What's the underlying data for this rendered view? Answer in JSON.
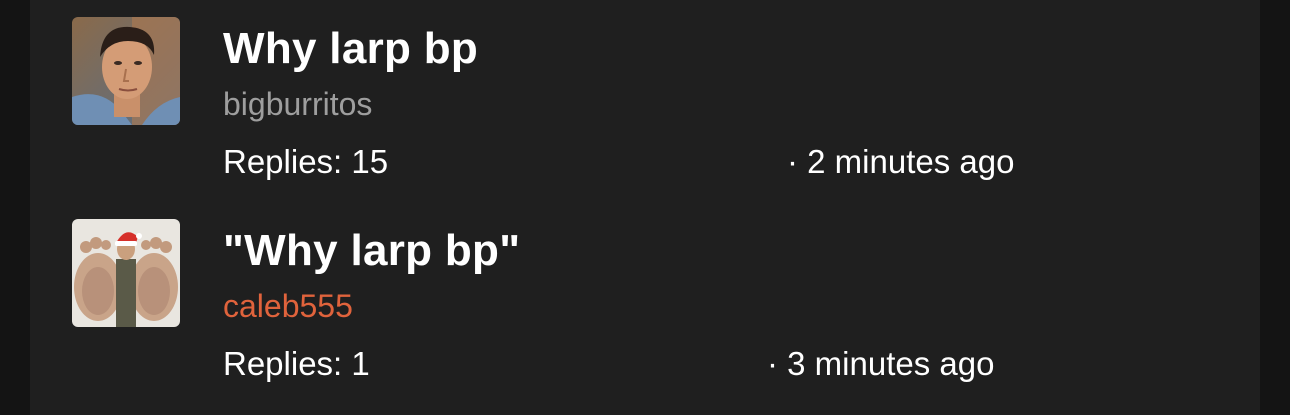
{
  "threads": [
    {
      "title": "Why larp bp",
      "author": "bigburritos",
      "author_color": "#9e9e9e",
      "replies": "Replies: 15",
      "time": "· 2 minutes ago",
      "avatar_icon": "user-portrait-avatar"
    },
    {
      "title": "\"Why larp bp\"",
      "author": "caleb555",
      "author_color": "#e0633c",
      "replies": "Replies: 1",
      "time": "· 3 minutes ago",
      "avatar_icon": "user-avatar-santa-hat"
    }
  ]
}
